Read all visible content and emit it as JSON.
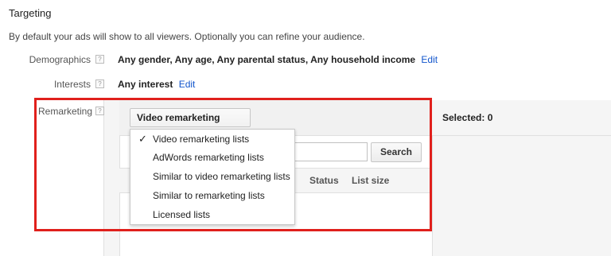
{
  "header": {
    "title": "Targeting",
    "description": "By default your ads will show to all viewers. Optionally you can refine your audience."
  },
  "rows": {
    "demographics": {
      "label": "Demographics",
      "help": "?",
      "value": "Any gender, Any age, Any parental status, Any household income",
      "edit": "Edit"
    },
    "interests": {
      "label": "Interests",
      "help": "?",
      "value": "Any interest",
      "edit": "Edit"
    },
    "remarketing": {
      "label": "Remarketing",
      "help": "?"
    }
  },
  "remarketing_panel": {
    "dropdown_label": "Video remarketing lists",
    "caret": "⌄",
    "selected_label": "Selected: 0",
    "search_button": "Search",
    "search_value": "",
    "columns": [
      "Status",
      "List size"
    ],
    "menu": {
      "check": "✓",
      "items": [
        {
          "label": "Video remarketing lists",
          "checked": true
        },
        {
          "label": "AdWords remarketing lists",
          "checked": false
        },
        {
          "label": "Similar to video remarketing lists",
          "checked": false
        },
        {
          "label": "Similar to remarketing lists",
          "checked": false
        },
        {
          "label": "Licensed lists",
          "checked": false
        }
      ]
    }
  },
  "colors": {
    "highlight": "#e0201c",
    "link": "#1155cc"
  }
}
